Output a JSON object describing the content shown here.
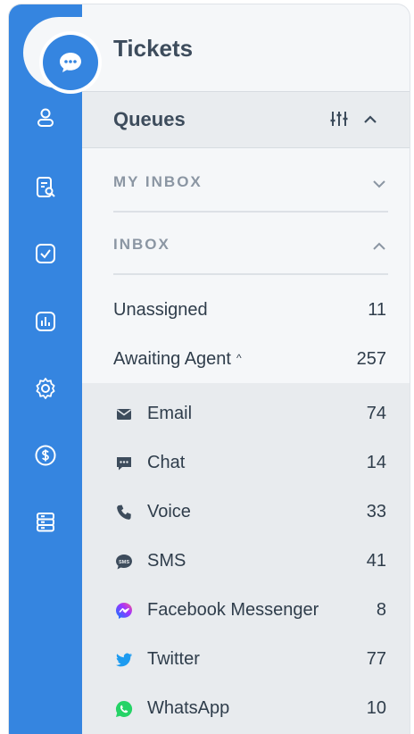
{
  "app": {
    "title": "Tickets"
  },
  "sidebar": {
    "items": [
      {
        "icon": "contacts-icon"
      },
      {
        "icon": "knowledge-search-icon"
      },
      {
        "icon": "tasks-check-icon"
      },
      {
        "icon": "reports-bar-chart-icon"
      },
      {
        "icon": "settings-gear-icon"
      },
      {
        "icon": "billing-dollar-icon"
      },
      {
        "icon": "database-icon"
      }
    ]
  },
  "queues": {
    "label": "Queues",
    "sections": [
      {
        "label": "MY INBOX",
        "expanded": false
      },
      {
        "label": "INBOX",
        "expanded": true
      }
    ],
    "rows": [
      {
        "label": "Unassigned",
        "count": "11"
      },
      {
        "label": "Awaiting Agent",
        "count": "257",
        "caret": "^"
      }
    ],
    "channels": [
      {
        "label": "Email",
        "count": "74",
        "icon": "email-icon"
      },
      {
        "label": "Chat",
        "count": "14",
        "icon": "chat-icon"
      },
      {
        "label": "Voice",
        "count": "33",
        "icon": "phone-icon"
      },
      {
        "label": "SMS",
        "count": "41",
        "icon": "sms-icon"
      },
      {
        "label": "Facebook Messenger",
        "count": "8",
        "icon": "messenger-icon"
      },
      {
        "label": "Twitter",
        "count": "77",
        "icon": "twitter-icon"
      },
      {
        "label": "WhatsApp",
        "count": "10",
        "icon": "whatsapp-icon"
      }
    ]
  },
  "colors": {
    "rail": "#3585e0",
    "messenger": "#7b4dff",
    "twitter": "#1d9bf0",
    "whatsapp": "#25d366"
  }
}
